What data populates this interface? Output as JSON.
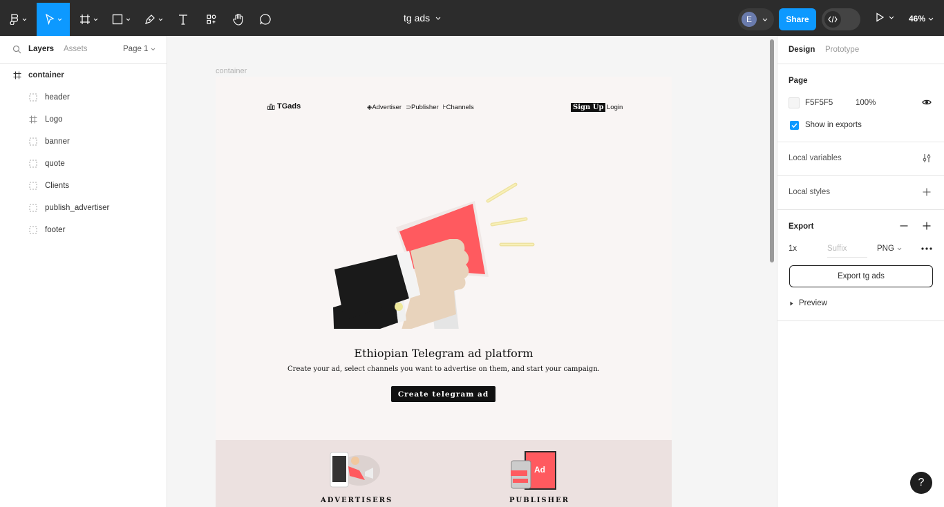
{
  "toolbar": {
    "file_title": "tg ads",
    "avatar_initial": "E",
    "share_label": "Share",
    "zoom_label": "46%",
    "accent": "#0d99ff",
    "tools": [
      "figma-menu-icon",
      "move-tool-icon",
      "frame-tool-icon",
      "shape-tool-icon",
      "pen-tool-icon",
      "text-tool-icon",
      "resources-icon",
      "hand-tool-icon",
      "comment-icon"
    ]
  },
  "left_panel": {
    "tab_layers": "Layers",
    "tab_assets": "Assets",
    "page_selector": "Page 1",
    "layers": [
      {
        "label": "container",
        "icon": "frame-icon"
      },
      {
        "label": "header",
        "icon": "section-icon"
      },
      {
        "label": "Logo",
        "icon": "frame-icon"
      },
      {
        "label": "banner",
        "icon": "section-icon"
      },
      {
        "label": "quote",
        "icon": "section-icon"
      },
      {
        "label": "Clients",
        "icon": "section-icon"
      },
      {
        "label": "publish_advertiser",
        "icon": "section-icon"
      },
      {
        "label": "footer",
        "icon": "section-icon"
      }
    ]
  },
  "canvas": {
    "frame_label": "container",
    "site": {
      "logo": "TGads",
      "nav": [
        "Advertiser",
        "Publisher",
        "Channels"
      ],
      "signup": "Sign Up",
      "login": "Login",
      "hero_title": "Ethiopian Telegram ad platform",
      "hero_subtitle": "Create your ad, select channels you want to advertise on them, and start your campaign.",
      "cta": "Create telegram ad",
      "advertisers_title": "ADVERTISERS",
      "publisher_title": "PUBLISHER",
      "ad_badge": "Ad"
    }
  },
  "right_panel": {
    "tab_design": "Design",
    "tab_prototype": "Prototype",
    "page_heading": "Page",
    "page_color": "F5F5F5",
    "page_opacity": "100%",
    "show_in_exports": "Show in exports",
    "local_variables": "Local variables",
    "local_styles": "Local styles",
    "export_heading": "Export",
    "export_scale": "1x",
    "export_suffix_placeholder": "Suffix",
    "export_format": "PNG",
    "export_button": "Export tg ads",
    "preview": "Preview"
  },
  "help_label": "?"
}
